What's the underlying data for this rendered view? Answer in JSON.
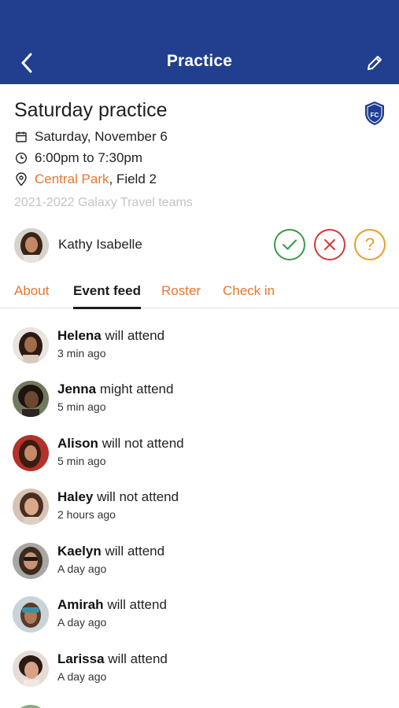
{
  "header": {
    "title": "Practice",
    "back_icon": "back-arrow-icon",
    "edit_icon": "pencil-icon",
    "bg_color": "#223f8f"
  },
  "event": {
    "title": "Saturday practice",
    "date": "Saturday, November 6",
    "time": "6:00pm to 7:30pm",
    "location_link": "Central Park",
    "location_rest": ", Field 2",
    "teams": "2021-2022 Galaxy Travel teams",
    "team_logo_text": "FC"
  },
  "rsvp": {
    "name": "Kathy Isabelle",
    "yes_icon": "check-icon",
    "no_icon": "x-icon",
    "maybe_label": "?"
  },
  "tabs": [
    {
      "label": "About",
      "active": false
    },
    {
      "label": "Event feed",
      "active": true
    },
    {
      "label": "Roster",
      "active": false
    },
    {
      "label": "Check in",
      "active": false
    }
  ],
  "feed": [
    {
      "name": "Helena",
      "status": "will attend",
      "time": "3 min ago",
      "avatar_color": "#6b4a3a"
    },
    {
      "name": "Jenna",
      "status": "might attend",
      "time": "5 min ago",
      "avatar_color": "#3d2a22"
    },
    {
      "name": "Alison",
      "status": "will not attend",
      "time": "5 min ago",
      "avatar_color": "#b83a2c"
    },
    {
      "name": "Haley",
      "status": "will not attend",
      "time": "2 hours ago",
      "avatar_color": "#c9a48a"
    },
    {
      "name": "Kaelyn",
      "status": "will attend",
      "time": "A day ago",
      "avatar_color": "#8a6a55"
    },
    {
      "name": "Amirah",
      "status": "will attend",
      "time": "A day ago",
      "avatar_color": "#5a7a8c"
    },
    {
      "name": "Larissa",
      "status": "will attend",
      "time": "A day ago",
      "avatar_color": "#a87a5a"
    }
  ],
  "colors": {
    "accent": "#e8762c",
    "yes": "#3a9a45",
    "no": "#d0393a",
    "maybe": "#ec9b2a"
  }
}
